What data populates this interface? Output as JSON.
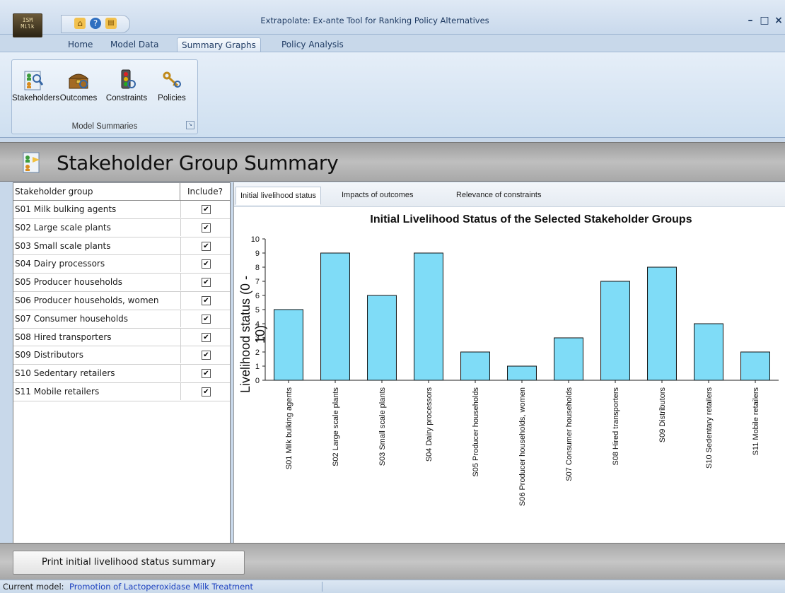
{
  "app": {
    "logo_text": "ISM\nMilk",
    "window_title": "Extrapolate: Ex-ante Tool for Ranking Policy Alternatives",
    "window_controls": {
      "minimize": "–",
      "maximize": "□",
      "close": "×"
    }
  },
  "quick_access": [
    {
      "icon": "home-icon"
    },
    {
      "icon": "help-icon"
    },
    {
      "icon": "document-icon"
    }
  ],
  "menu_tabs": [
    {
      "label": "Home",
      "active": false
    },
    {
      "label": "Model Data",
      "active": false
    },
    {
      "label": "Summary Graphs",
      "active": true
    },
    {
      "label": "Policy Analysis",
      "active": false
    }
  ],
  "ribbon": {
    "group_label": "Model Summaries",
    "buttons": [
      {
        "label": "Stakeholders",
        "icon": "stakeholders-icon"
      },
      {
        "label": "Outcomes",
        "icon": "treasure-chest-icon"
      },
      {
        "label": "Constraints",
        "icon": "traffic-light-icon"
      },
      {
        "label": "Policies",
        "icon": "keys-icon"
      }
    ]
  },
  "page": {
    "title": "Stakeholder Group Summary"
  },
  "table": {
    "headers": {
      "group": "Stakeholder group",
      "include": "Include?"
    },
    "rows": [
      {
        "group": "S01 Milk bulking agents",
        "include": true
      },
      {
        "group": "S02 Large scale plants",
        "include": true
      },
      {
        "group": "S03 Small scale plants",
        "include": true
      },
      {
        "group": "S04 Dairy processors",
        "include": true
      },
      {
        "group": "S05 Producer households",
        "include": true
      },
      {
        "group": "S06 Producer households, women",
        "include": true
      },
      {
        "group": "S07 Consumer households",
        "include": true
      },
      {
        "group": "S08 Hired transporters",
        "include": true
      },
      {
        "group": "S09 Distributors",
        "include": true
      },
      {
        "group": "S10 Sedentary retailers",
        "include": true
      },
      {
        "group": "S11 Mobile retailers",
        "include": true
      }
    ]
  },
  "chart_tabs": [
    {
      "label": "Initial livelihood status",
      "active": true
    },
    {
      "label": "Impacts of outcomes",
      "active": false
    },
    {
      "label": "Relevance of constraints",
      "active": false
    }
  ],
  "chart_data": {
    "type": "bar",
    "title": "Initial Livelihood Status of the Selected Stakeholder Groups",
    "ylabel": "Livelihood status (0 - 10)",
    "xlabel": "",
    "ylim": [
      0,
      10
    ],
    "yticks": [
      0,
      1,
      2,
      3,
      4,
      5,
      6,
      7,
      8,
      9,
      10
    ],
    "bar_color": "#7fdcf7",
    "categories": [
      "S01 Milk bulking agents",
      "S02 Large scale plants",
      "S03 Small scale plants",
      "S04 Dairy processors",
      "S05 Producer households",
      "S06 Producer households, women",
      "S07 Consumer households",
      "S08 Hired transporters",
      "S09 Distributors",
      "S10 Sedentary retailers",
      "S11 Mobile retailers"
    ],
    "values": [
      5,
      9,
      6,
      9,
      2,
      1,
      3,
      7,
      8,
      4,
      2
    ]
  },
  "actions": {
    "print_label": "Print initial livelihood status summary"
  },
  "status": {
    "label": "Current model:",
    "model_name": "Promotion of Lactoperoxidase Milk Treatment",
    "link_color": "#1a3fbf"
  }
}
